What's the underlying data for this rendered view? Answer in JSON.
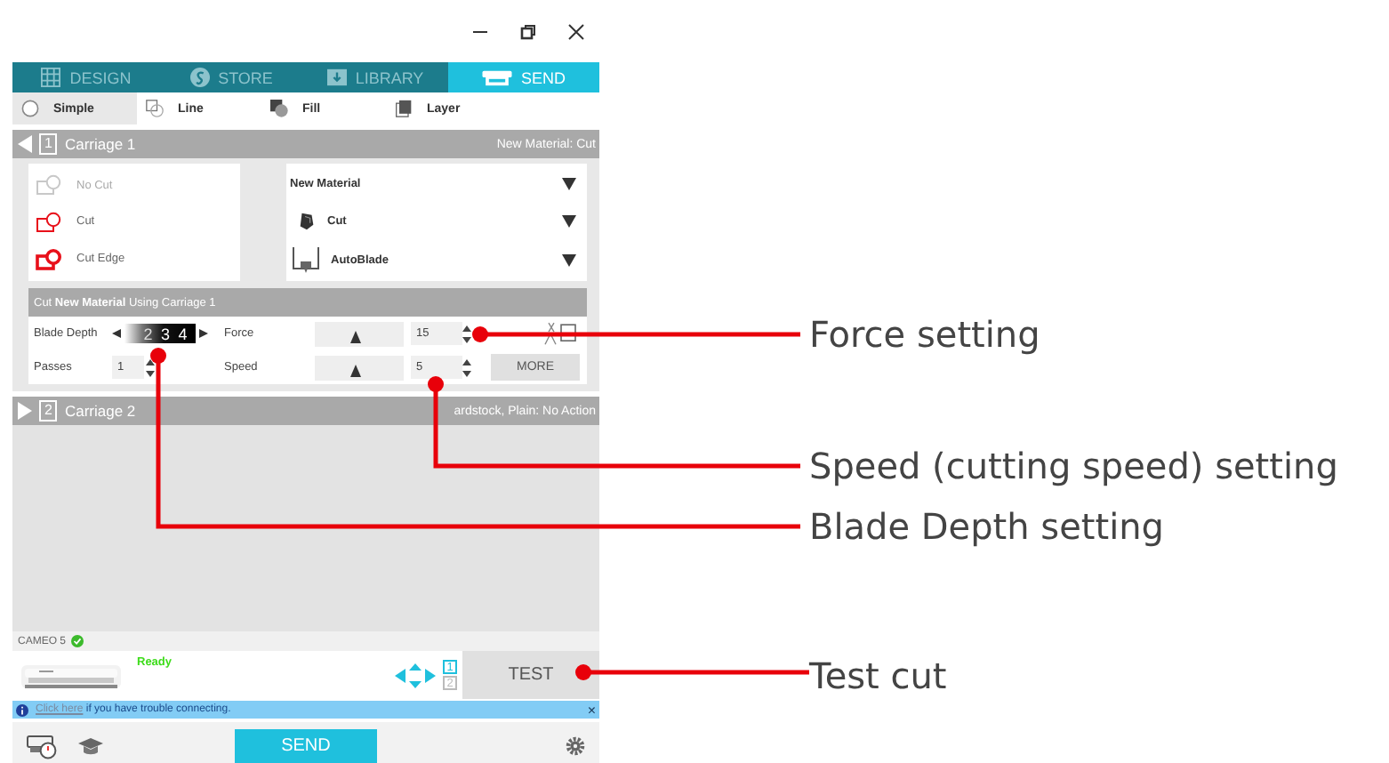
{
  "tabs": [
    {
      "label": "DESIGN",
      "kind": "design",
      "selected": false
    },
    {
      "label": "STORE",
      "kind": "store",
      "selected": false
    },
    {
      "label": "LIBRARY",
      "kind": "library",
      "selected": false
    },
    {
      "label": "SEND",
      "kind": "send",
      "selected": true
    }
  ],
  "modes": [
    {
      "label": "Simple",
      "kind": "simple",
      "selected": true
    },
    {
      "label": "Line",
      "kind": "line",
      "selected": false
    },
    {
      "label": "Fill",
      "kind": "fill",
      "selected": false
    },
    {
      "label": "Layer",
      "kind": "layer",
      "selected": false
    }
  ],
  "carriage_1": {
    "number": "1",
    "title": "Carriage 1",
    "summary": "New Material: Cut",
    "expanded": true
  },
  "cut_styles": [
    {
      "label": "No Cut",
      "kind": "no_cut"
    },
    {
      "label": "Cut",
      "kind": "cut"
    },
    {
      "label": "Cut Edge",
      "kind": "cut_edge"
    }
  ],
  "dropdowns": [
    {
      "value": "New Material",
      "kind": "material"
    },
    {
      "value": "Cut",
      "kind": "action"
    },
    {
      "value": "AutoBlade",
      "kind": "tool"
    }
  ],
  "settings": {
    "heading": "Cut **New Material** Using Carriage 1",
    "blade_depth": {
      "label": "Blade Depth",
      "scale": [
        "2",
        "3",
        "4"
      ]
    },
    "passes": {
      "label": "Passes",
      "value": "1"
    },
    "force": {
      "label": "Force",
      "level": 0.45,
      "value": "15"
    },
    "speed": {
      "label": "Speed",
      "level": 0.45,
      "value": "5"
    },
    "more_button": "MORE"
  },
  "carriage_2": {
    "number": "2",
    "title": "Carriage 2",
    "summary": "ardstock, Plain: No Action",
    "expanded": false
  },
  "device": {
    "name": "CAMEO 5",
    "status": "Ready",
    "carriages": [
      {
        "label": "1",
        "selected": true
      },
      {
        "label": "2",
        "selected": false
      }
    ],
    "test_button": "TEST"
  },
  "info_bar": {
    "link": "Click here",
    "text": " if you have trouble connecting.",
    "close": "×"
  },
  "send_button": "SEND",
  "annotations": [
    {
      "label": "Force setting",
      "kind": "force"
    },
    {
      "label": "Speed (cutting speed) setting",
      "kind": "speed"
    },
    {
      "label": "Blade Depth setting",
      "kind": "blade_depth"
    },
    {
      "label": "Test cut",
      "kind": "test"
    }
  ]
}
